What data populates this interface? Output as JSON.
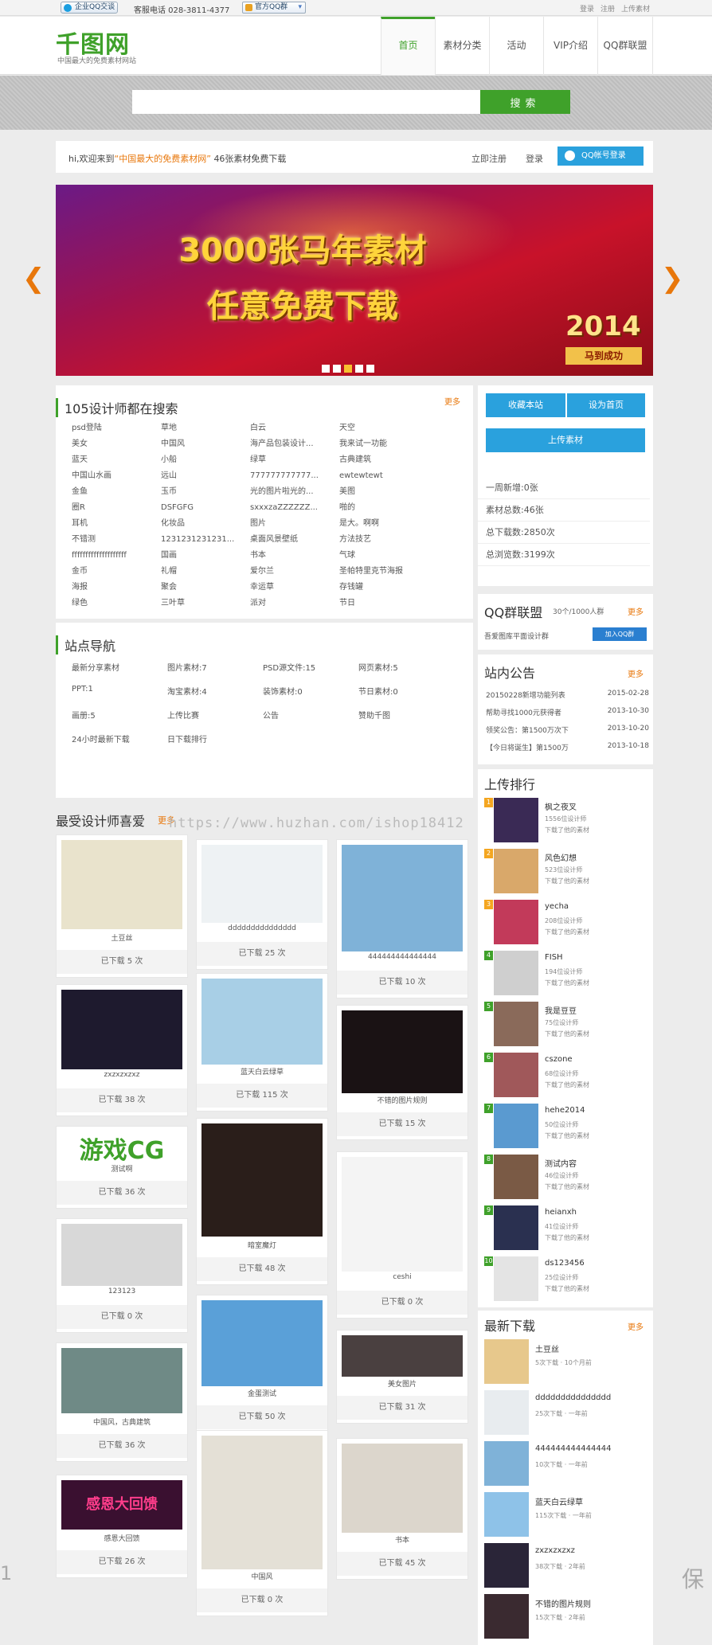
{
  "topbar": {
    "qq_service": "企业QQ交谈",
    "phone": "客服电话 028-3811-4377",
    "qq_group": "官方QQ群",
    "links": [
      "登录",
      "注册",
      "上传素材"
    ]
  },
  "header": {
    "logo": "千图网",
    "logo_sub": "中国最大的免费素材网站",
    "nav": [
      "首页",
      "素材分类",
      "活动",
      "VIP介绍",
      "QQ群联盟"
    ]
  },
  "search": {
    "placeholder": "",
    "button": "搜索"
  },
  "welcome": {
    "prefix": "hi,欢迎来到",
    "site": "“中国最大的免费素材网”",
    "suffix": "46张素材免费下载",
    "register": "立即注册",
    "login": "登录",
    "qq_login": "QQ帐号登录"
  },
  "banner": {
    "title": "3000张马年素材",
    "subtitle": "任意免费下载",
    "year": "2014",
    "tag": "马到成功"
  },
  "hot_search": {
    "title": "105设计师都在搜索",
    "more": "更多",
    "keywords": [
      "psd登陆",
      "草地",
      "白云",
      "天空",
      "美女",
      "中国风",
      "海产品包装设计...",
      "我来试一功能",
      "蓝天",
      "小船",
      "绿草",
      "古典建筑",
      "中国山水画",
      "远山",
      "777777777777...",
      "ewtewtewt",
      "金鱼",
      "玉币",
      "光的图片啦光的...",
      "美图",
      "圈R",
      "DSFGFG",
      "sxxxzaZZZZZZ...",
      "啪的",
      "耳机",
      "化妆品",
      "图片",
      "是大。啊啊",
      "不错测",
      "1231231231231...",
      "桌面风景壁纸",
      "方法技艺",
      "ffffffffffffffffffff",
      "国画",
      "书本",
      "气球",
      "金币",
      "礼帽",
      "爱尔兰",
      "圣帕特里克节海报",
      "海报",
      "聚会",
      "幸运草",
      "存钱罐",
      "绿色",
      "三叶草",
      "派对",
      "节日"
    ]
  },
  "site_nav": {
    "title": "站点导航",
    "items": [
      "最新分享素材",
      "图片素材:7",
      "PSD源文件:15",
      "网页素材:5",
      "PPT:1",
      "淘宝素材:4",
      "装饰素材:0",
      "节日素材:0",
      "画册:5",
      "上传比赛",
      "公告",
      "赞助千图",
      "24小时最新下载",
      "日下载排行"
    ]
  },
  "sidebar": {
    "bookmark": "收藏本站",
    "set_home": "设为首页",
    "upload": "上传素材",
    "stats": [
      {
        "label": "一周新增:",
        "value": "0张"
      },
      {
        "label": "素材总数:",
        "value": "46张"
      },
      {
        "label": "总下载数:",
        "value": "2850次"
      },
      {
        "label": "总浏览数:",
        "value": "3199次"
      }
    ],
    "qq_union": {
      "title": "QQ群联盟",
      "count": "30个/1000人群",
      "more": "更多",
      "group": "吾爱图库平面设计群",
      "join": "加入QQ群"
    },
    "notice": {
      "title": "站内公告",
      "more": "更多",
      "items": [
        {
          "text": "20150228新增功能列表",
          "date": "2015-02-28"
        },
        {
          "text": "帮助寻找1000元获得者",
          "date": "2013-10-30"
        },
        {
          "text": "领奖公告：第1500万次下",
          "date": "2013-10-20"
        },
        {
          "text": "【今日将诞生】第1500万",
          "date": "2013-10-18"
        }
      ]
    },
    "upload_rank": {
      "title": "上传排行",
      "items": [
        {
          "rank": "1",
          "name": "枫之夜叉",
          "count": "1556位设计师",
          "note": "下载了他的素材",
          "color": "#3a2a55"
        },
        {
          "rank": "2",
          "name": "风色幻想",
          "count": "523位设计师",
          "note": "下载了他的素材",
          "color": "#d9a86a"
        },
        {
          "rank": "3",
          "name": "yecha",
          "count": "208位设计师",
          "note": "下载了他的素材",
          "color": "#c23a5a"
        },
        {
          "rank": "4",
          "name": "FISH",
          "count": "194位设计师",
          "note": "下载了他的素材",
          "color": "#cfcfcf"
        },
        {
          "rank": "5",
          "name": "我是豆豆",
          "count": "75位设计师",
          "note": "下载了他的素材",
          "color": "#8a6a5a"
        },
        {
          "rank": "6",
          "name": "cszone",
          "count": "68位设计师",
          "note": "下载了他的素材",
          "color": "#a0585a"
        },
        {
          "rank": "7",
          "name": "hehe2014",
          "count": "50位设计师",
          "note": "下载了他的素材",
          "color": "#5a9ad0"
        },
        {
          "rank": "8",
          "name": "测试内容",
          "count": "46位设计师",
          "note": "下载了他的素材",
          "color": "#7a5a45"
        },
        {
          "rank": "9",
          "name": "heianxh",
          "count": "41位设计师",
          "note": "下载了他的素材",
          "color": "#2a3050"
        },
        {
          "rank": "10",
          "name": "ds123456",
          "count": "25位设计师",
          "note": "下载了他的素材",
          "color": "#e4e4e4"
        }
      ]
    },
    "latest": {
      "title": "最新下载",
      "more": "更多",
      "items": [
        {
          "name": "土豆丝",
          "meta": "5次下载 · 10个月前",
          "color": "#e7c88c"
        },
        {
          "name": "ddddddddddddddd",
          "meta": "25次下载 · 一年前",
          "color": "#e8ecef"
        },
        {
          "name": "444444444444444",
          "meta": "10次下载 · 一年前",
          "color": "#7fb2d8"
        },
        {
          "name": "蓝天白云绿草",
          "meta": "115次下载 · 一年前",
          "color": "#8ec2e8"
        },
        {
          "name": "zxzxzxzxz",
          "meta": "38次下载 · 2年前",
          "color": "#2a2538"
        },
        {
          "name": "不错的图片规则",
          "meta": "15次下载 · 2年前",
          "color": "#3a2a30"
        }
      ]
    }
  },
  "favorites": {
    "title": "最受设计师喜爱",
    "more": "更多",
    "col1": [
      {
        "caption": "土豆丝",
        "downloads": "已下载 5 次"
      },
      {
        "caption": "zxzxzxzxz",
        "downloads": "已下载 38 次"
      },
      {
        "caption": "测试啊",
        "downloads": "已下载 36 次",
        "art": "游戏CG"
      },
      {
        "caption": "123123",
        "downloads": "已下载 0 次"
      },
      {
        "caption": "中国风，古典建筑",
        "downloads": "已下载 36 次"
      },
      {
        "caption": "感恩大回馈",
        "downloads": "已下载 26 次",
        "art": "感恩大回馈"
      }
    ],
    "col2": [
      {
        "caption": "ddddddddddddddd",
        "downloads": "已下载 25 次"
      },
      {
        "caption": "蓝天白云绿草",
        "downloads": "已下载 115 次"
      },
      {
        "caption": "暗室魔灯",
        "downloads": "已下载 48 次"
      },
      {
        "caption": "金蛋测试",
        "downloads": "已下载 50 次"
      },
      {
        "caption": "中国风",
        "downloads": "已下载 0 次"
      }
    ],
    "col3": [
      {
        "caption": "444444444444444",
        "downloads": "已下载 10 次"
      },
      {
        "caption": "不错的图片规则",
        "downloads": "已下载 15 次"
      },
      {
        "caption": "ceshi",
        "downloads": "已下载 0 次"
      },
      {
        "caption": "美女图片",
        "downloads": "已下载 31 次"
      },
      {
        "caption": "书本",
        "downloads": "已下载 45 次"
      }
    ]
  },
  "watermark": {
    "url": "https://www.huzhan.com/ishop18412",
    "edge_left": "1",
    "edge_right": "保"
  },
  "colors": {
    "brand_green": "#3fa12a",
    "accent_orange": "#e8770b",
    "button_blue": "#2aa1dd"
  }
}
